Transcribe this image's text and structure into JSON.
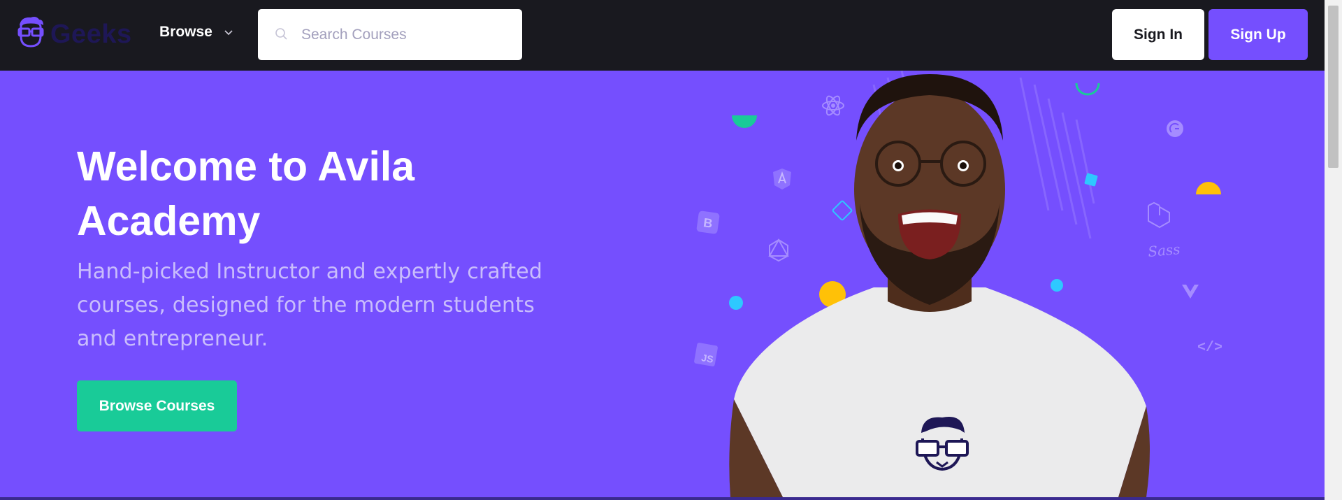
{
  "brand": {
    "name": "Geeks",
    "accent": "#754ffe",
    "dark": "#19191f"
  },
  "nav": {
    "browse_label": "Browse",
    "search_placeholder": "Search Courses",
    "signin_label": "Sign In",
    "signup_label": "Sign Up"
  },
  "hero": {
    "title": "Welcome to Avila Academy",
    "subtitle": "Hand-picked Instructor and expertly crafted courses, designed for the modern students and entrepreneur.",
    "cta_label": "Browse Courses",
    "cta_color": "#19cb98",
    "tech_icons": [
      "react-icon",
      "angular-icon",
      "bootstrap-icon",
      "graphql-icon",
      "javascript-icon",
      "gatsby-icon",
      "laravel-icon",
      "sass-icon",
      "vue-icon",
      "code-icon"
    ]
  }
}
